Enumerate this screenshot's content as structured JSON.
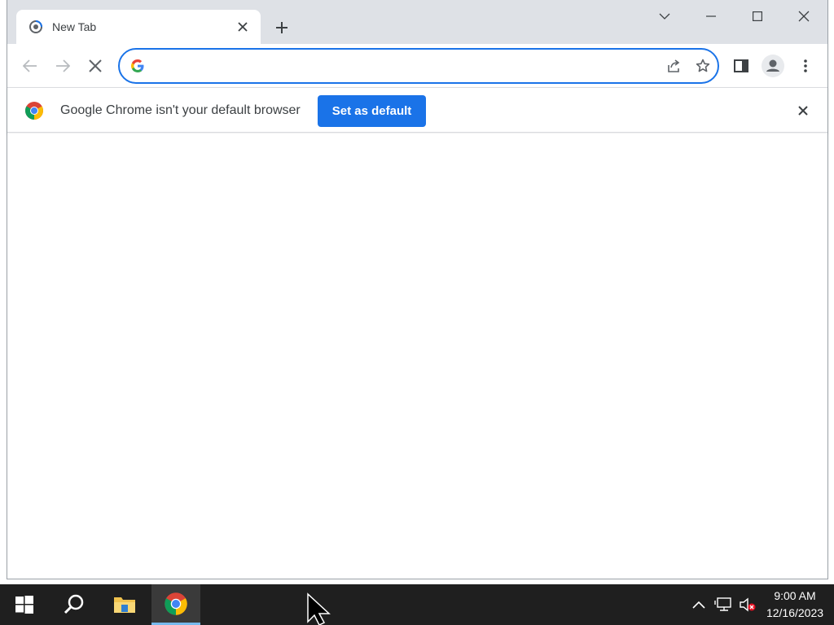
{
  "browser": {
    "tab": {
      "title": "New Tab"
    },
    "window_controls": [
      "tab-search",
      "minimize",
      "maximize",
      "close"
    ],
    "omnibox": {
      "value": "",
      "placeholder": ""
    },
    "infobar": {
      "message": "Google Chrome isn't your default browser",
      "button_label": "Set as default"
    }
  },
  "colors": {
    "accent": "#1a73e8",
    "titlebar": "#dee1e6",
    "taskbar": "#1f1f1f"
  },
  "taskbar": {
    "apps": [
      "start-icon",
      "search-icon",
      "file-explorer-icon",
      "chrome-icon"
    ],
    "time": "9:00 AM",
    "date": "12/16/2023"
  }
}
